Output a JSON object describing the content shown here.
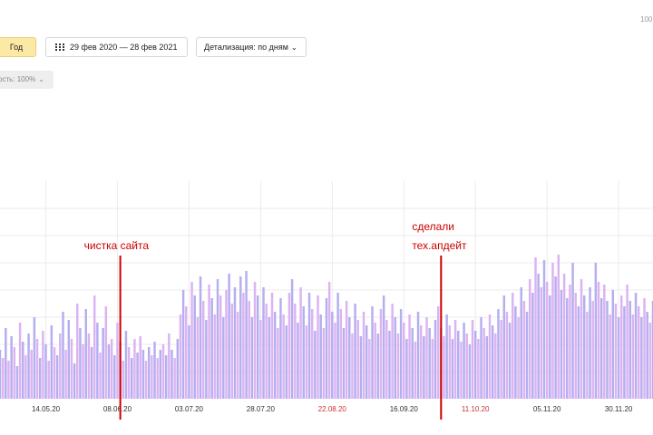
{
  "toolbar": {
    "period_year": "Год",
    "date_range": "29 фев 2020 — 28 фев 2021",
    "detail": "Детализация: по дням",
    "accuracy": "ость: 100%",
    "top_right": "100"
  },
  "colors": {
    "series_a": "#b5aef0",
    "series_b": "#dcb3f2",
    "annotation": "#cc0000",
    "tick_normal": "#333333",
    "tick_weekend": "#cc3333",
    "grid": "#ebebeb"
  },
  "chart_data": {
    "type": "bar",
    "x_tick_labels": [
      {
        "label": "14.05.20",
        "weekend": false
      },
      {
        "label": "08.06.20",
        "weekend": false
      },
      {
        "label": "03.07.20",
        "weekend": false
      },
      {
        "label": "28.07.20",
        "weekend": false
      },
      {
        "label": "22.08.20",
        "weekend": true
      },
      {
        "label": "16.09.20",
        "weekend": false
      },
      {
        "label": "11.10.20",
        "weekend": true
      },
      {
        "label": "05.11.20",
        "weekend": false
      },
      {
        "label": "30.11.20",
        "weekend": false
      }
    ],
    "x_range": [
      "2020-04-28",
      "2020-12-12"
    ],
    "y_range": [
      0,
      8
    ],
    "grid": true,
    "series": [
      {
        "values": [
          1.8,
          1.5,
          2.6,
          1.4,
          2.3,
          1.9,
          1.2,
          2.8,
          2.1,
          1.6,
          2.4,
          1.8,
          3.0,
          2.2,
          1.5,
          2.5,
          2.0,
          1.4,
          2.7,
          1.9,
          1.6,
          2.4,
          3.2,
          1.8,
          2.9,
          2.2,
          1.3,
          3.5,
          2.6,
          2.0,
          3.3,
          2.4,
          1.9,
          3.8,
          2.8,
          1.7,
          2.6,
          3.4,
          2.0,
          2.2,
          1.6,
          2.8,
          2.1,
          1.4,
          2.5,
          1.9,
          1.5,
          2.2,
          1.7,
          2.3,
          1.8,
          1.4,
          1.9,
          1.6,
          2.1,
          1.5,
          1.8,
          2.0,
          1.6,
          2.4,
          1.8,
          1.5,
          2.2,
          3.1,
          4.0,
          3.4,
          2.7,
          4.3,
          3.8,
          3.0,
          4.5,
          3.6,
          2.9,
          4.2,
          3.7,
          3.1,
          4.4,
          3.8,
          3.0,
          4.0,
          4.6,
          3.5,
          4.1,
          3.2,
          4.5,
          3.9,
          4.7,
          3.6,
          3.0,
          4.3,
          3.8,
          2.9,
          4.1,
          3.5,
          3.0,
          3.9,
          3.2,
          2.6,
          3.7,
          3.1,
          2.7,
          3.9,
          4.4,
          3.5,
          2.8,
          4.1,
          3.4,
          2.7,
          3.9,
          3.3,
          2.5,
          3.8,
          3.1,
          2.6,
          3.7,
          4.3,
          3.2,
          2.8,
          3.9,
          3.3,
          2.6,
          3.6,
          3.0,
          2.4,
          3.5,
          2.9,
          2.3,
          3.2,
          2.7,
          2.2,
          3.4,
          2.8,
          2.4,
          3.3,
          3.8,
          2.9,
          2.5,
          3.5,
          3.0,
          2.4,
          3.3,
          2.8,
          2.2,
          3.1,
          2.6,
          2.1,
          3.2,
          2.7,
          2.3,
          3.0,
          2.6,
          2.2,
          2.9,
          3.4,
          2.6,
          2.3,
          3.1,
          2.7,
          2.2,
          2.9,
          2.5,
          2.1,
          2.8,
          2.4,
          2.0,
          2.9,
          2.5,
          2.2,
          3.0,
          2.6,
          2.3,
          3.1,
          2.7,
          2.4,
          3.3,
          2.9,
          3.8,
          3.2,
          2.8,
          3.9,
          3.4,
          3.0,
          4.1,
          3.6,
          3.2,
          4.4,
          3.9,
          5.2,
          4.6,
          4.1,
          5.1,
          4.3,
          3.8,
          5.0,
          4.5,
          5.3,
          4.0,
          4.6,
          3.7,
          4.2,
          5.0,
          3.9,
          3.4,
          4.4,
          3.8,
          3.2,
          4.1,
          3.6,
          5.0,
          4.3,
          3.7,
          4.2,
          3.6,
          3.1,
          4.0,
          3.5,
          3.0,
          3.8,
          3.4,
          4.2,
          3.6,
          3.1,
          3.9,
          3.4,
          3.0,
          3.7,
          3.2,
          2.8,
          3.6,
          4.0,
          3.3,
          2.9,
          3.8,
          3.2,
          2.7,
          3.6,
          3.1,
          2.6,
          4.6,
          3.9,
          3.2,
          4.3,
          3.6,
          3.0,
          3.9,
          3.4,
          2.9,
          3.7,
          3.2,
          2.7,
          3.5,
          3.0,
          2.5,
          3.3,
          2.8,
          2.4,
          3.4,
          3.0,
          2.6,
          3.6,
          3.1,
          2.5,
          3.2,
          2.8,
          2.3,
          3.0,
          2.7,
          2.2,
          3.2,
          2.8
        ]
      }
    ],
    "annotations": [
      {
        "date": "2020-06-09",
        "lines": [
          "чистка сайта"
        ]
      },
      {
        "date": "2020-09-29",
        "lines": [
          "сделали",
          "тех.апдейт"
        ]
      }
    ]
  }
}
